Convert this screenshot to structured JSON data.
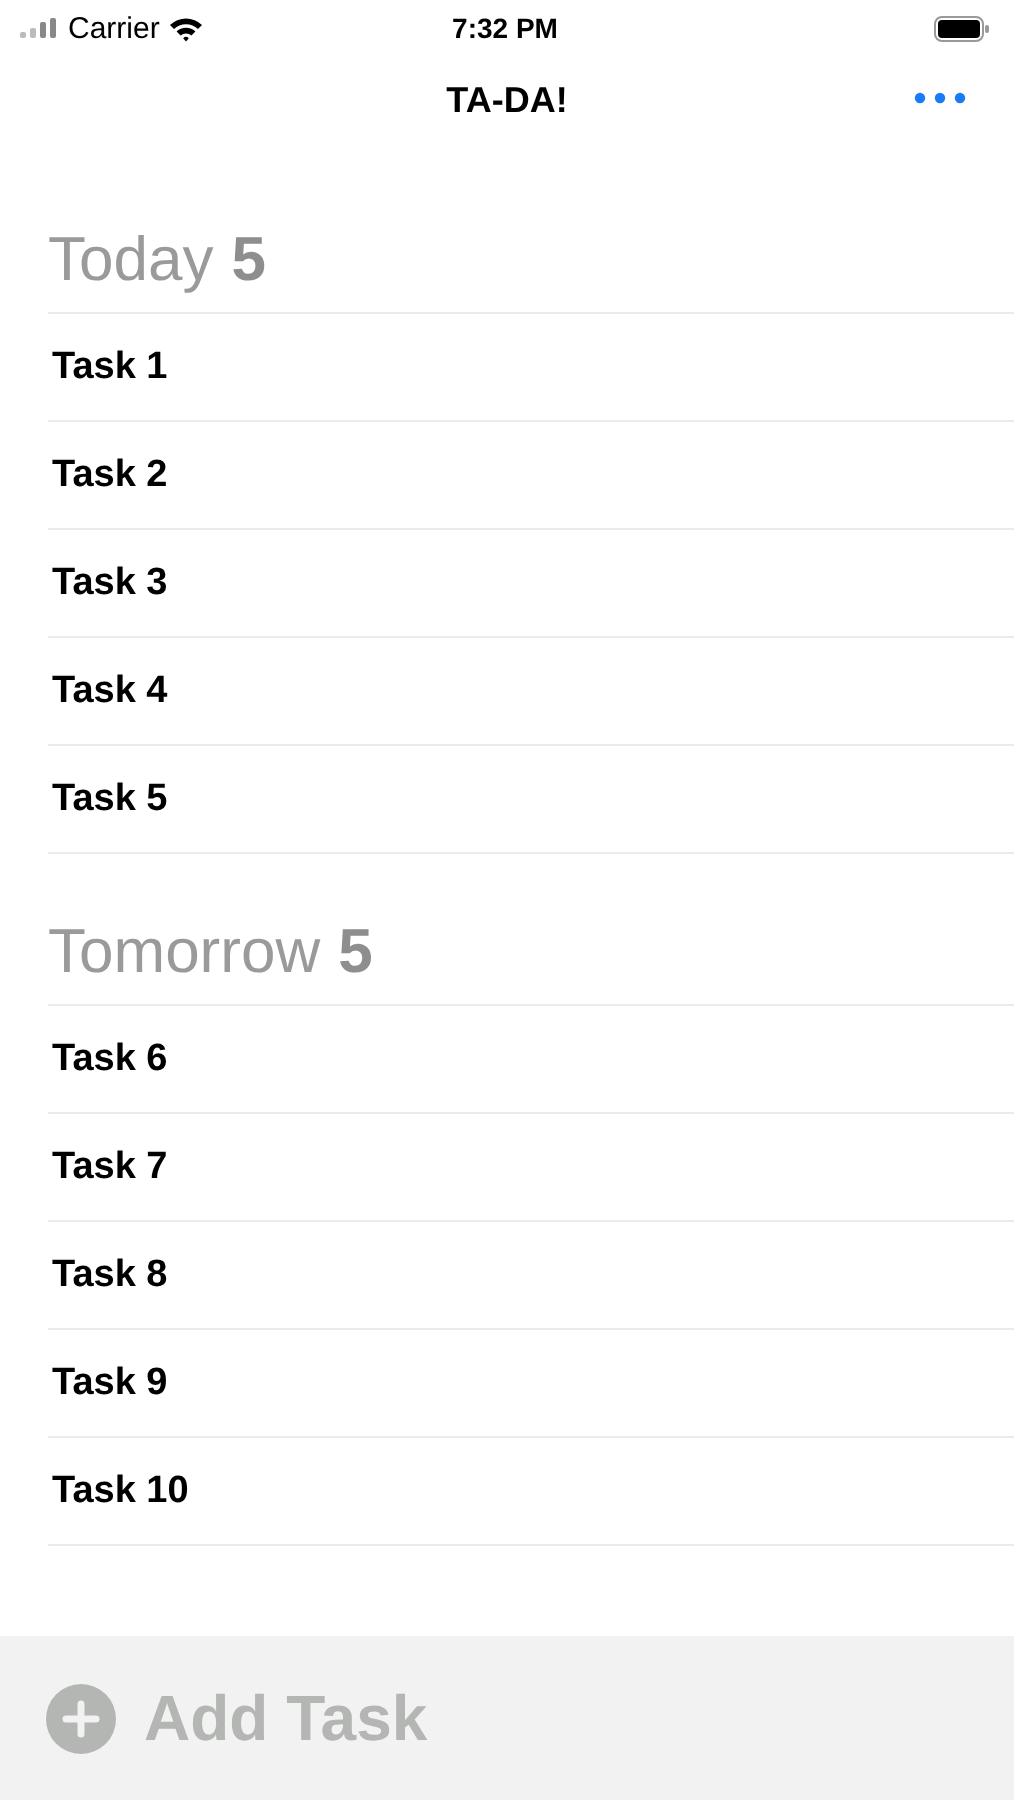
{
  "status_bar": {
    "carrier": "Carrier",
    "time": "7:32 PM"
  },
  "nav": {
    "title": "TA-DA!"
  },
  "sections": [
    {
      "title": "Today",
      "count": "5",
      "tasks": [
        {
          "title": "Task 1"
        },
        {
          "title": "Task 2"
        },
        {
          "title": "Task 3"
        },
        {
          "title": "Task 4"
        },
        {
          "title": "Task 5"
        }
      ]
    },
    {
      "title": "Tomorrow",
      "count": "5",
      "tasks": [
        {
          "title": "Task 6"
        },
        {
          "title": "Task 7"
        },
        {
          "title": "Task 8"
        },
        {
          "title": "Task 9"
        },
        {
          "title": "Task 10"
        }
      ]
    }
  ],
  "add_task": {
    "label": "Add Task"
  }
}
